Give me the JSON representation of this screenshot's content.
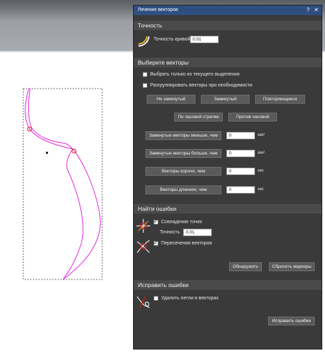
{
  "colors": {
    "panel_bg": "#3a3a3a",
    "title_bg": "#2e4f7f",
    "curve": "#e020e0",
    "button_bg": "#5a5a5a"
  },
  "panel": {
    "title": "Лечение векторов",
    "help": "?",
    "close": "✕"
  },
  "accuracy_section": {
    "title": "Точность",
    "curve_accuracy_label": "Точность кривой",
    "curve_accuracy_value": "0.01"
  },
  "select_section": {
    "title": "Выберите векторы",
    "only_selection_label": "Выбрать только из текущего выделения",
    "ungroup_label": "Разгруппировать векторы при необходимости",
    "btn_open": "Не замкнутый",
    "btn_closed": "Замкнутый",
    "btn_duplicates": "Повторяющиеся",
    "btn_clockwise": "По часовой стрелке",
    "btn_counterclockwise": "Против часовой",
    "btn_closed_smaller": "Замкнутые векторы меньше, чем",
    "closed_smaller_value": "0",
    "closed_smaller_unit": "мм²",
    "btn_closed_larger": "Замкнутые векторы больше, чем",
    "closed_larger_value": "0",
    "closed_larger_unit": "мм²",
    "btn_shorter": "Векторы короче, чем",
    "shorter_value": "0",
    "shorter_unit": "мм",
    "btn_longer": "Векторы длиннее, чем",
    "longer_value": "0",
    "longer_unit": "мм"
  },
  "find_section": {
    "title": "Найти ошибки",
    "coincident_label": "Совпадение точек",
    "coincident_checked": true,
    "accuracy_label": "Точность",
    "accuracy_value": "0.01",
    "intersections_label": "Пересечения векторов",
    "intersections_checked": true,
    "btn_find": "Обнаружить",
    "btn_reset": "Сбросить маркеры"
  },
  "fix_section": {
    "title": "Исправить ошибки",
    "remove_loops_label": "Удалить петли в векторах",
    "remove_loops_checked": false,
    "btn_fix": "Исправить ошибки"
  }
}
